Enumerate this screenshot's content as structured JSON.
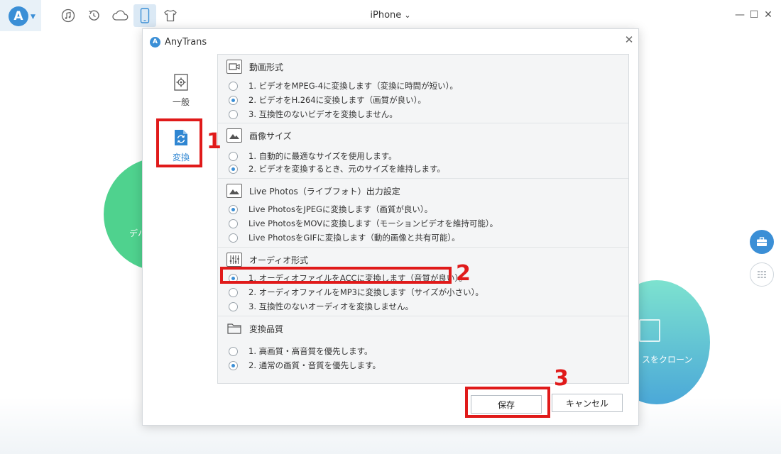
{
  "app": {
    "logo_letter": "A",
    "device": "iPhone",
    "device_caret": "⌄"
  },
  "titlebar_icons": [
    "music-icon",
    "history-icon",
    "cloud-icon",
    "phone-icon",
    "shirt-icon"
  ],
  "window_controls": {
    "minimize": "—",
    "maximize": "☐",
    "close": "✕"
  },
  "background": {
    "left_circle_text": "デバ",
    "right_circle_text": "スをクローン"
  },
  "dialog": {
    "title": "AnyTrans",
    "close": "✕",
    "tabs": [
      {
        "label": "一般",
        "icon": "gear-icon"
      },
      {
        "label": "変換",
        "icon": "convert-icon"
      }
    ],
    "sections": [
      {
        "title": "動画形式",
        "icon": "video-icon",
        "options": [
          {
            "label": "1. ビデオをMPEG-4に変換します（変換に時間が短い）。",
            "selected": false
          },
          {
            "label": "2. ビデオをH.264に変換します（画質が良い）。",
            "selected": true
          },
          {
            "label": "3. 互換性のないビデオを変換しません。",
            "selected": false
          }
        ]
      },
      {
        "title": "画像サイズ",
        "icon": "image-icon",
        "options": [
          {
            "label": "1. 自動的に最適なサイズを使用します。",
            "selected": false
          },
          {
            "label": "2. ビデオを変換するとき、元のサイズを維持します。",
            "selected": true
          }
        ]
      },
      {
        "title": "Live Photos（ライブフォト）出力設定",
        "icon": "live-photo-icon",
        "options": [
          {
            "label": "Live PhotosをJPEGに変換します（画質が良い）。",
            "selected": true
          },
          {
            "label": "Live PhotosをMOVに変換します（モーションビデオを維持可能）。",
            "selected": false
          },
          {
            "label": "Live PhotosをGIFに変換します（動的画像と共有可能）。",
            "selected": false
          }
        ]
      },
      {
        "title": "オーディオ形式",
        "icon": "audio-icon",
        "options": [
          {
            "label": "1. オーディオファイルをACCに変換します（音質が良い）。",
            "selected": true
          },
          {
            "label": "2. オーディオファイルをMP3に変換します（サイズが小さい）。",
            "selected": false
          },
          {
            "label": "3. 互換性のないオーディオを変換しません。",
            "selected": false
          }
        ]
      },
      {
        "title": "変換品質",
        "icon": "folder-icon",
        "options": [
          {
            "label": "1. 高画質・高音質を優先します。",
            "selected": false
          },
          {
            "label": "2. 通常の画質・音質を優先します。",
            "selected": true
          }
        ]
      }
    ],
    "save": "保存",
    "cancel": "キャンセル"
  },
  "annotations": {
    "n1": "1",
    "n2": "2",
    "n3": "3",
    "color": "#e01a1a"
  }
}
